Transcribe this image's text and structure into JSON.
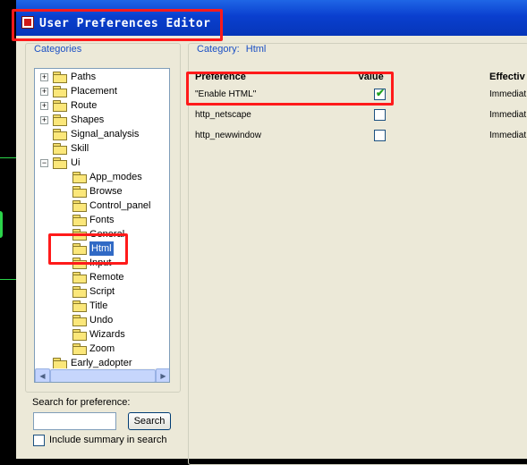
{
  "window": {
    "title": "User Preferences Editor"
  },
  "categories": {
    "label": "Categories",
    "tree": [
      {
        "label": "Paths",
        "expander": "+"
      },
      {
        "label": "Placement",
        "expander": "+"
      },
      {
        "label": "Route",
        "expander": "+"
      },
      {
        "label": "Shapes",
        "expander": "+"
      },
      {
        "label": "Signal_analysis",
        "expander": ""
      },
      {
        "label": "Skill",
        "expander": ""
      },
      {
        "label": "Ui",
        "expander": "−"
      },
      {
        "label": "App_modes",
        "expander": ""
      },
      {
        "label": "Browse",
        "expander": ""
      },
      {
        "label": "Control_panel",
        "expander": ""
      },
      {
        "label": "Fonts",
        "expander": ""
      },
      {
        "label": "General",
        "expander": ""
      },
      {
        "label": "Html",
        "expander": "",
        "selected": true
      },
      {
        "label": "Input",
        "expander": ""
      },
      {
        "label": "Remote",
        "expander": ""
      },
      {
        "label": "Script",
        "expander": ""
      },
      {
        "label": "Title",
        "expander": ""
      },
      {
        "label": "Undo",
        "expander": ""
      },
      {
        "label": "Wizards",
        "expander": ""
      },
      {
        "label": "Zoom",
        "expander": ""
      },
      {
        "label": "Early_adopter",
        "expander": ""
      }
    ],
    "scroll_up_icon": "▲",
    "scroll_down_icon": "▼",
    "scroll_left_icon": "◀",
    "scroll_right_icon": "▶"
  },
  "search": {
    "label": "Search for preference:",
    "value": "",
    "button": "Search",
    "include_summary_label": "Include summary in search",
    "include_summary_checked": false
  },
  "category_panel": {
    "label": "Category:",
    "category_name": "Html",
    "columns": [
      "Preference",
      "Value",
      "Effectiv"
    ],
    "rows": [
      {
        "preference": "\"Enable HTML\"",
        "checked": true,
        "effective": "Immediat"
      },
      {
        "preference": "http_netscape",
        "checked": false,
        "effective": "Immediat"
      },
      {
        "preference": "http_newwindow",
        "checked": false,
        "effective": "Immediat"
      }
    ]
  },
  "colors": {
    "title_bar": "#0a3fcf",
    "group_label": "#1a4fc4",
    "selection": "#316ac5",
    "highlight": "#ff1a1a"
  }
}
